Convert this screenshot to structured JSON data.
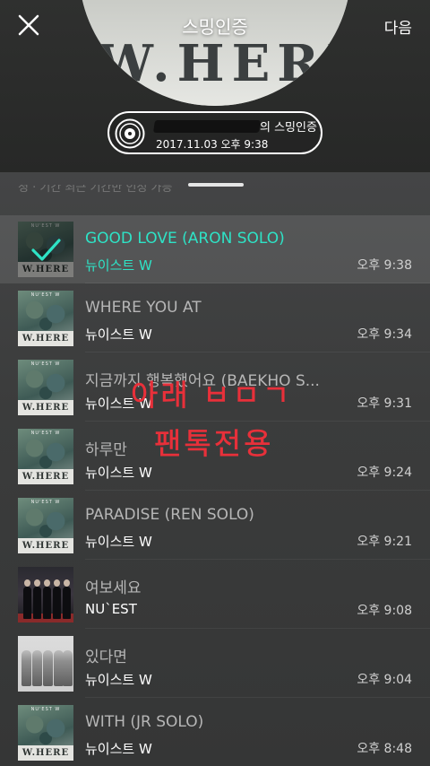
{
  "header": {
    "title": "스밍인증",
    "next_label": "다음",
    "album_logo": "W.HERE",
    "certificate": {
      "owner_suffix": "의 스밍인증",
      "datetime": "2017.11.03 오후 9:38"
    }
  },
  "sheet": {
    "cut_text": "청 · 기간 최근 기간만 인정 가능"
  },
  "tracks": [
    {
      "title": "GOOD LOVE (ARON SOLO)",
      "artist": "뉴이스트 W",
      "time": "오후 9:38",
      "selected": true,
      "art": "where"
    },
    {
      "title": "WHERE YOU AT",
      "artist": "뉴이스트 W",
      "time": "오후 9:34",
      "selected": false,
      "art": "where"
    },
    {
      "title": "지금까지 행복했어요 (BAEKHO S...",
      "artist": "뉴이스트 W",
      "time": "오후 9:31",
      "selected": false,
      "art": "where"
    },
    {
      "title": "하루만",
      "artist": "뉴이스트 W",
      "time": "오후 9:24",
      "selected": false,
      "art": "where"
    },
    {
      "title": "PARADISE (REN SOLO)",
      "artist": "뉴이스트 W",
      "time": "오후 9:21",
      "selected": false,
      "art": "where"
    },
    {
      "title": "여보세요",
      "artist": "NU`EST",
      "time": "오후 9:08",
      "selected": false,
      "art": "group"
    },
    {
      "title": "있다면",
      "artist": "뉴이스트 W",
      "time": "오후 9:04",
      "selected": false,
      "art": "mono"
    },
    {
      "title": "WITH (JR SOLO)",
      "artist": "뉴이스트 W",
      "time": "오후 8:48",
      "selected": false,
      "art": "where"
    }
  ],
  "thumb_labels": {
    "where": "W.HERE",
    "tag": "NU'EST W"
  },
  "overlay": {
    "line1": "아래 ㅂㅁㄱ",
    "line2": "팬톡전용",
    "color": "#e8303a"
  },
  "colors": {
    "accent": "#2ee3c6",
    "background": "#3a3b3a"
  },
  "icons": {
    "close": "close-icon",
    "disc": "disc-icon",
    "check": "check-icon"
  }
}
